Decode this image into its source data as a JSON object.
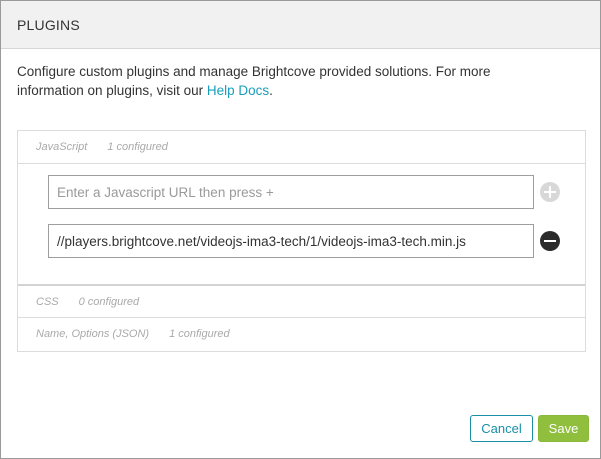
{
  "dialog": {
    "title": "PLUGINS",
    "description_text": "Configure custom plugins and manage Brightcove provided solutions. For more information on plugins, visit our ",
    "help_link": "Help Docs",
    "description_end": "."
  },
  "sections": {
    "javascript": {
      "label": "JavaScript",
      "count": "1 configured"
    },
    "css": {
      "label": "CSS",
      "count": "0 configured"
    },
    "name_options": {
      "label": "Name, Options (JSON)",
      "count": "1 configured"
    }
  },
  "js_inputs": {
    "new_placeholder": "Enter a Javascript URL then press +",
    "new_value": "",
    "existing_value": "//players.brightcove.net/videojs-ima3-tech/1/videojs-ima3-tech.min.js"
  },
  "icons": {
    "add": "plus-circle-icon",
    "remove": "minus-circle-icon"
  },
  "buttons": {
    "cancel": "Cancel",
    "save": "Save"
  },
  "colors": {
    "link": "#1a9dbb",
    "cancel_border": "#1a8fa8",
    "save_bg": "#8fbf3c",
    "remove_icon": "#2b2b2b",
    "add_icon": "#d8d8d8"
  }
}
